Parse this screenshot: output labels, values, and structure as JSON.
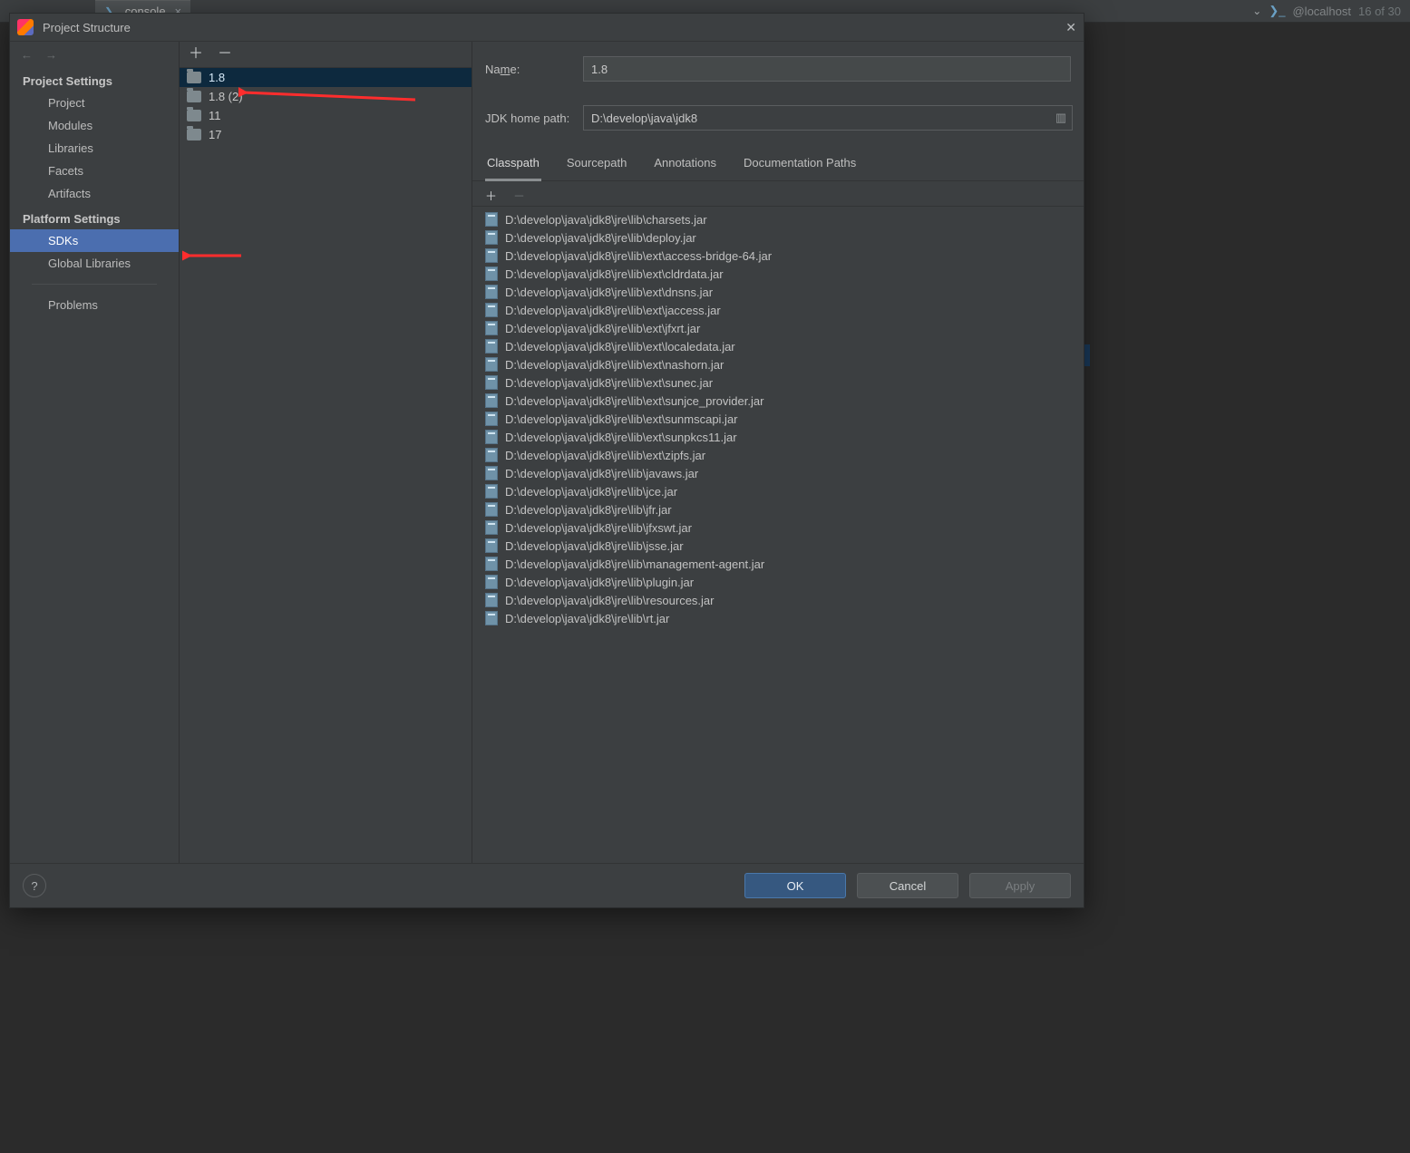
{
  "topbar": {
    "console_tab": "console",
    "hostbar": {
      "chevron": "⌄",
      "label": "@localhost",
      "count": "16 of 30"
    }
  },
  "dialog": {
    "title": "Project Structure",
    "nav_back": "←",
    "nav_fwd": "→",
    "close": "✕"
  },
  "nav": {
    "project_settings_header": "Project Settings",
    "project": "Project",
    "modules": "Modules",
    "libraries": "Libraries",
    "facets": "Facets",
    "artifacts": "Artifacts",
    "platform_settings_header": "Platform Settings",
    "sdks": "SDKs",
    "global_libs": "Global Libraries",
    "problems": "Problems"
  },
  "midtools": {
    "plus": "＋",
    "minus": "－"
  },
  "sdks": [
    {
      "label": "1.8",
      "selected": true
    },
    {
      "label": "1.8 (2)",
      "selected": false
    },
    {
      "label": "11",
      "selected": false
    },
    {
      "label": "17",
      "selected": false
    }
  ],
  "form": {
    "name_label_pre": "Na",
    "name_label_u": "m",
    "name_label_post": "e:",
    "name_value": "1.8",
    "path_label": "JDK home path:",
    "path_value": "D:\\develop\\java\\jdk8"
  },
  "tabs": {
    "classpath": "Classpath",
    "sourcepath": "Sourcepath",
    "annotations": "Annotations",
    "docpaths": "Documentation Paths"
  },
  "cp_tools": {
    "plus": "＋",
    "minus": "－"
  },
  "classpath": [
    "D:\\develop\\java\\jdk8\\jre\\lib\\charsets.jar",
    "D:\\develop\\java\\jdk8\\jre\\lib\\deploy.jar",
    "D:\\develop\\java\\jdk8\\jre\\lib\\ext\\access-bridge-64.jar",
    "D:\\develop\\java\\jdk8\\jre\\lib\\ext\\cldrdata.jar",
    "D:\\develop\\java\\jdk8\\jre\\lib\\ext\\dnsns.jar",
    "D:\\develop\\java\\jdk8\\jre\\lib\\ext\\jaccess.jar",
    "D:\\develop\\java\\jdk8\\jre\\lib\\ext\\jfxrt.jar",
    "D:\\develop\\java\\jdk8\\jre\\lib\\ext\\localedata.jar",
    "D:\\develop\\java\\jdk8\\jre\\lib\\ext\\nashorn.jar",
    "D:\\develop\\java\\jdk8\\jre\\lib\\ext\\sunec.jar",
    "D:\\develop\\java\\jdk8\\jre\\lib\\ext\\sunjce_provider.jar",
    "D:\\develop\\java\\jdk8\\jre\\lib\\ext\\sunmscapi.jar",
    "D:\\develop\\java\\jdk8\\jre\\lib\\ext\\sunpkcs11.jar",
    "D:\\develop\\java\\jdk8\\jre\\lib\\ext\\zipfs.jar",
    "D:\\develop\\java\\jdk8\\jre\\lib\\javaws.jar",
    "D:\\develop\\java\\jdk8\\jre\\lib\\jce.jar",
    "D:\\develop\\java\\jdk8\\jre\\lib\\jfr.jar",
    "D:\\develop\\java\\jdk8\\jre\\lib\\jfxswt.jar",
    "D:\\develop\\java\\jdk8\\jre\\lib\\jsse.jar",
    "D:\\develop\\java\\jdk8\\jre\\lib\\management-agent.jar",
    "D:\\develop\\java\\jdk8\\jre\\lib\\plugin.jar",
    "D:\\develop\\java\\jdk8\\jre\\lib\\resources.jar",
    "D:\\develop\\java\\jdk8\\jre\\lib\\rt.jar"
  ],
  "footer": {
    "help": "?",
    "ok": "OK",
    "cancel": "Cancel",
    "apply": "Apply"
  }
}
